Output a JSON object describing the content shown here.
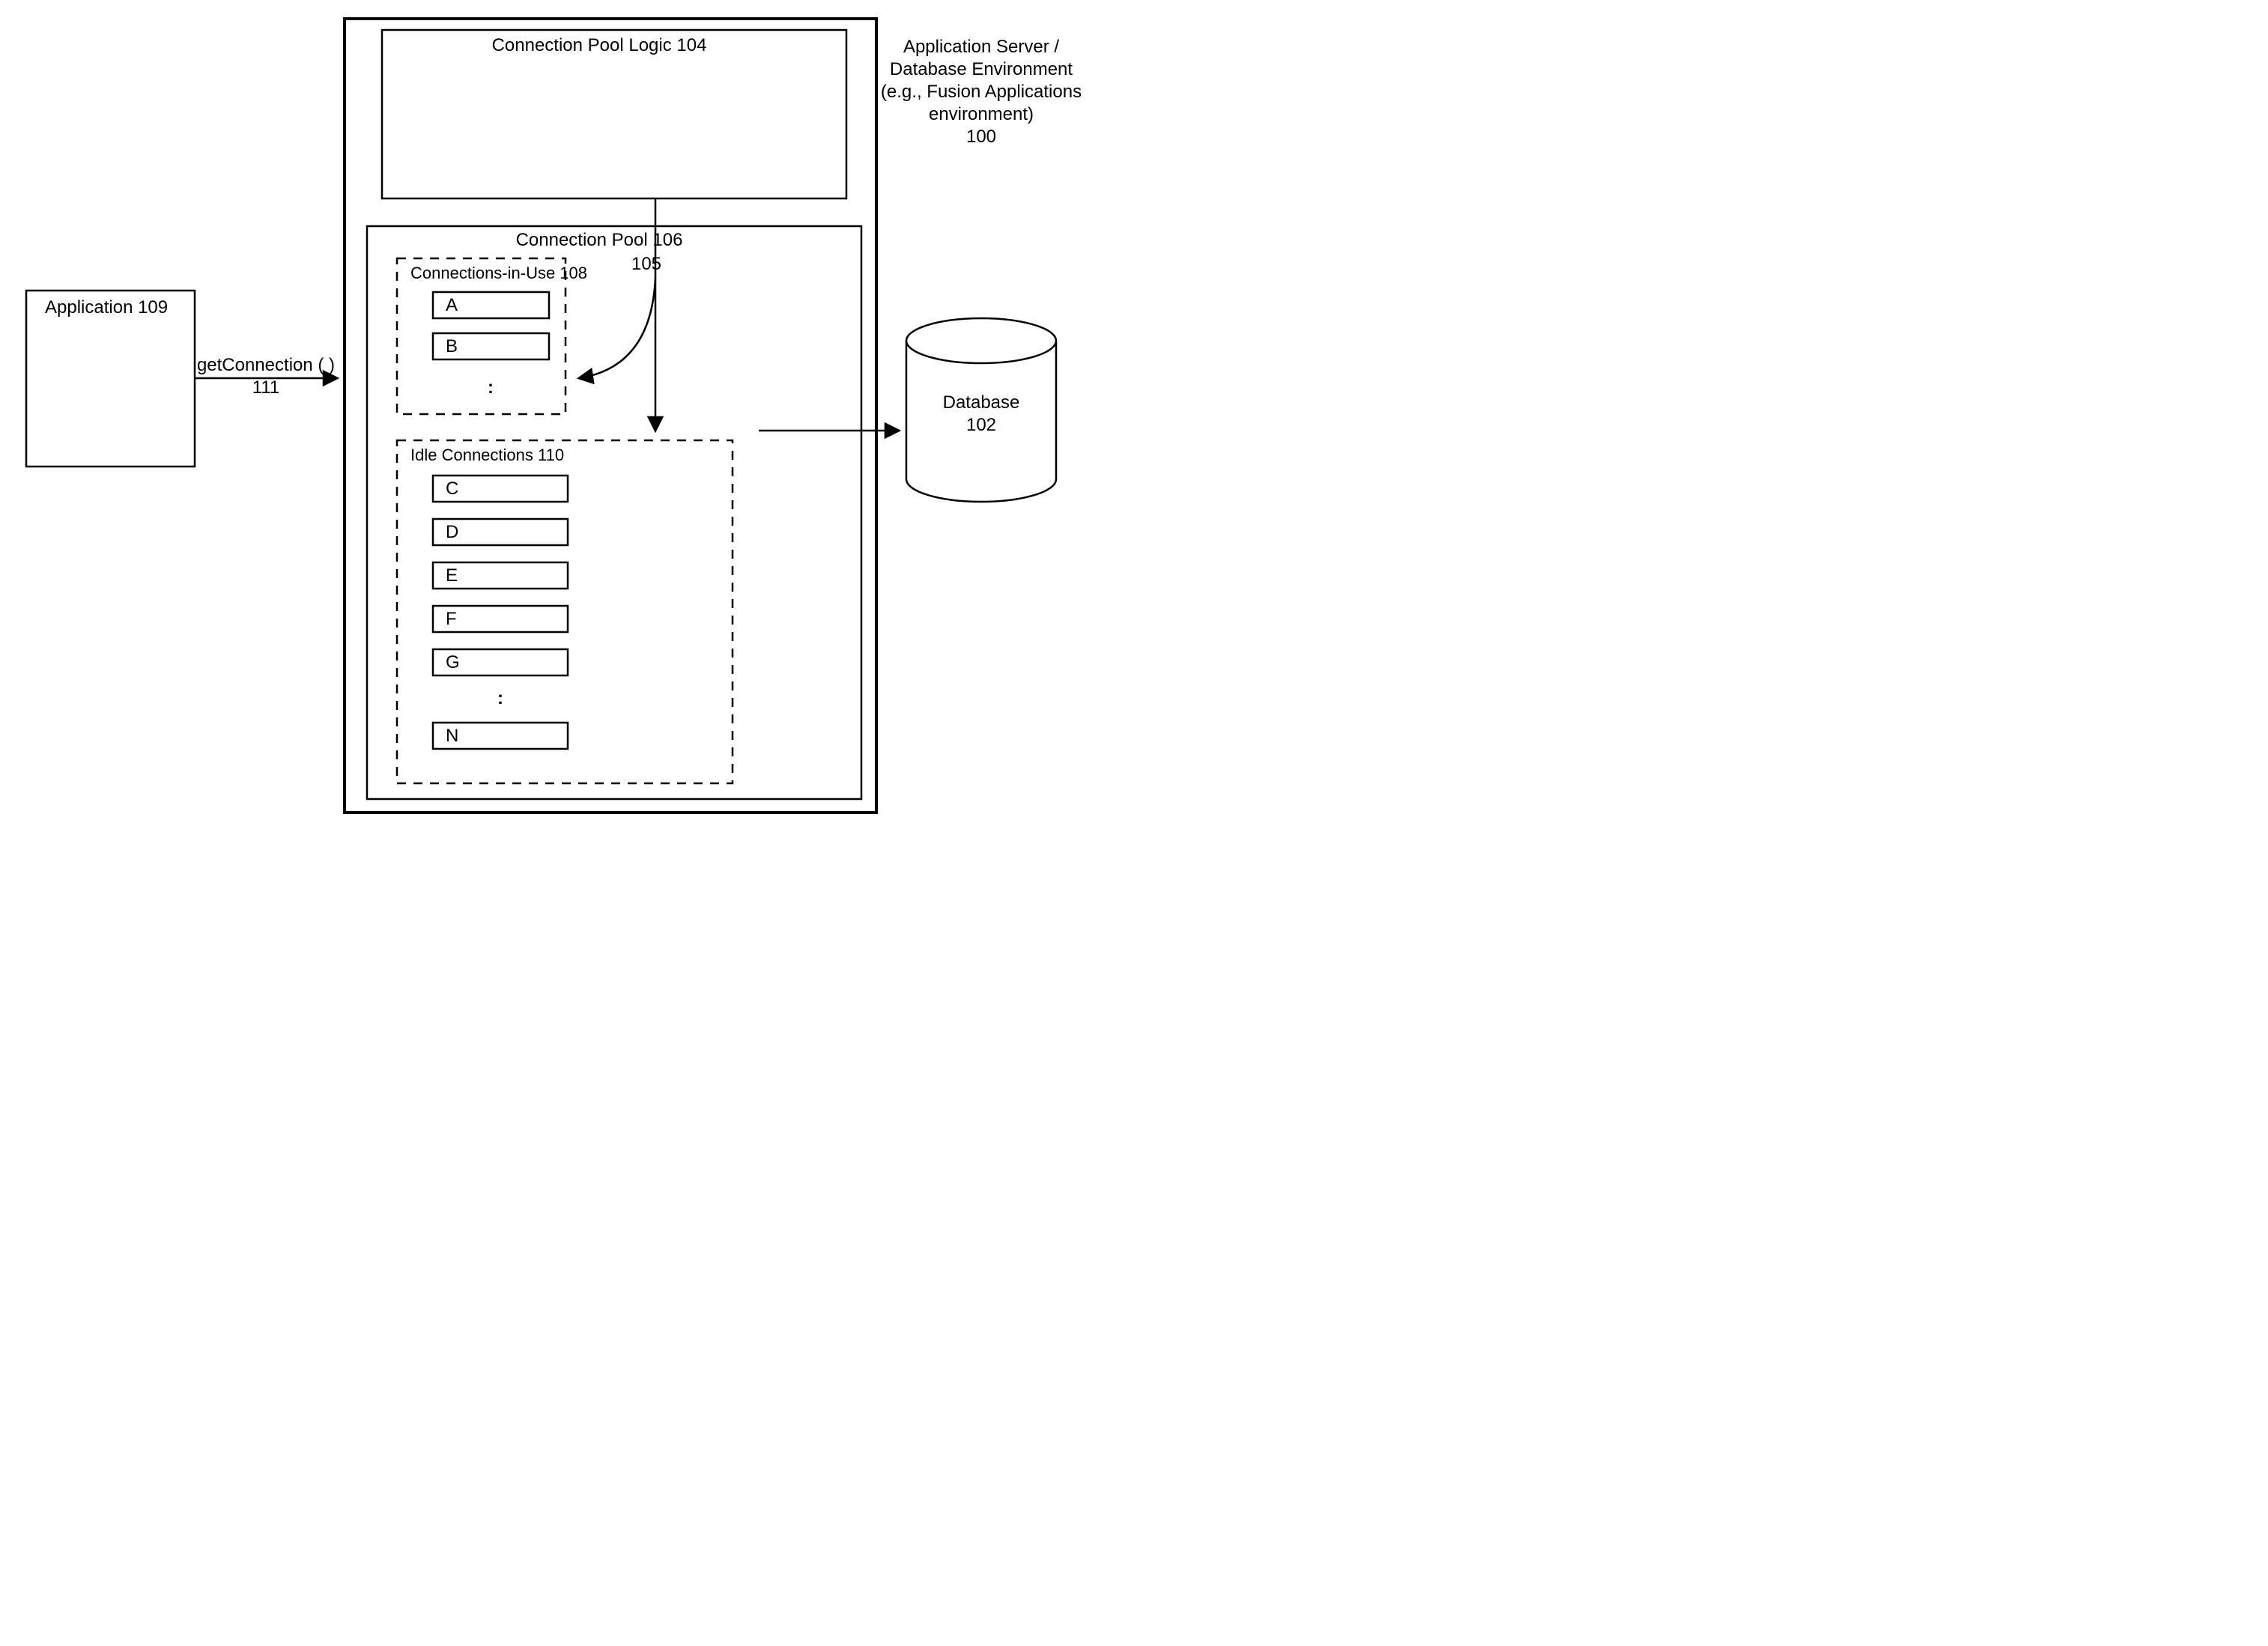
{
  "env": {
    "line1": "Application Server /",
    "line2": "Database Environment",
    "line3": "(e.g., Fusion Applications",
    "line4": "environment)",
    "line5": "100"
  },
  "application": {
    "label": "Application 109"
  },
  "getConnection": {
    "label": "getConnection ( )",
    "num": "111"
  },
  "poolLogic": {
    "label": "Connection Pool Logic 104"
  },
  "arrowDownNum": "105",
  "pool": {
    "label": "Connection Pool 106"
  },
  "inUse": {
    "label": "Connections-in-Use 108",
    "items": [
      "A",
      "B"
    ],
    "ellipsis": ":"
  },
  "idle": {
    "label": "Idle Connections 110",
    "items": [
      "C",
      "D",
      "E",
      "F",
      "G"
    ],
    "ellipsis": ":",
    "last": "N"
  },
  "database": {
    "label": "Database",
    "num": "102"
  }
}
